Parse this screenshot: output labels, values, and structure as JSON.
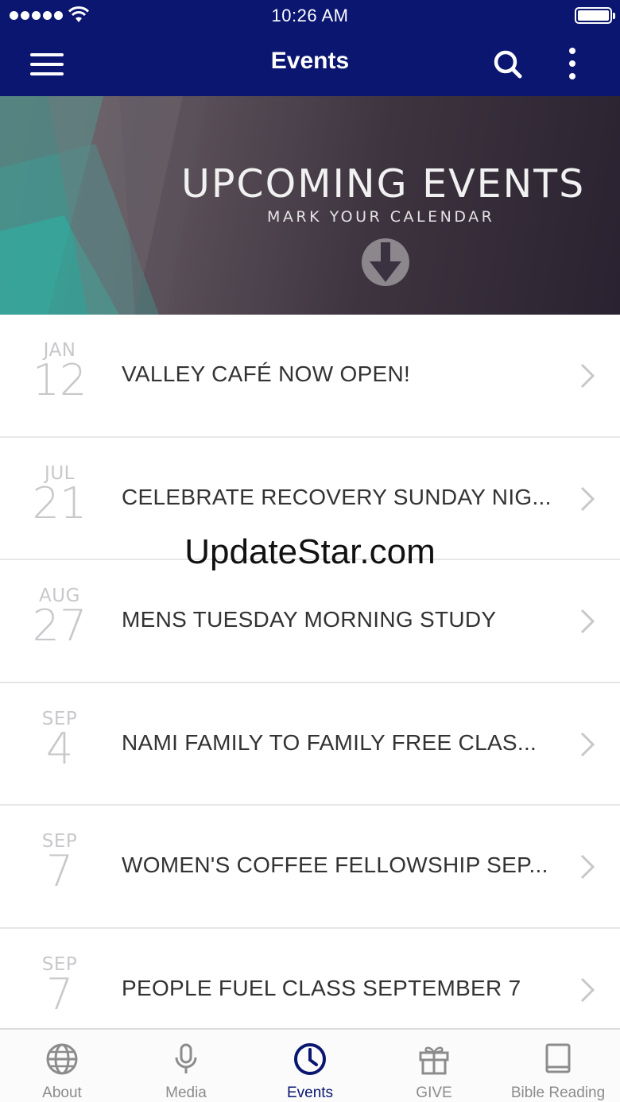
{
  "status_bar": {
    "time": "10:26 AM"
  },
  "nav": {
    "title": "Events"
  },
  "banner": {
    "title": "UPCOMING EVENTS",
    "subtitle": "MARK YOUR CALENDAR"
  },
  "events": [
    {
      "month": "JAN",
      "day": "12",
      "title": "VALLEY CAFÉ NOW OPEN!"
    },
    {
      "month": "JUL",
      "day": "21",
      "title": "CELEBRATE RECOVERY SUNDAY NIG..."
    },
    {
      "month": "AUG",
      "day": "27",
      "title": "MENS TUESDAY MORNING STUDY"
    },
    {
      "month": "SEP",
      "day": "4",
      "title": "NAMI FAMILY TO FAMILY FREE CLAS..."
    },
    {
      "month": "SEP",
      "day": "7",
      "title": "WOMEN'S COFFEE FELLOWSHIP SEP..."
    },
    {
      "month": "SEP",
      "day": "7",
      "title": "PEOPLE FUEL CLASS SEPTEMBER 7"
    }
  ],
  "watermark": "UpdateStar.com",
  "tabs": [
    {
      "label": "About",
      "icon": "globe-icon"
    },
    {
      "label": "Media",
      "icon": "microphone-icon"
    },
    {
      "label": "Events",
      "icon": "clock-icon",
      "active": true
    },
    {
      "label": "GIVE",
      "icon": "gift-icon"
    },
    {
      "label": "Bible Reading",
      "icon": "book-icon"
    }
  ],
  "colors": {
    "nav_background": "#0a1670",
    "active_tab": "#0a1670",
    "inactive_tab": "#8c8c8c",
    "date_text": "#c8c8cc"
  }
}
